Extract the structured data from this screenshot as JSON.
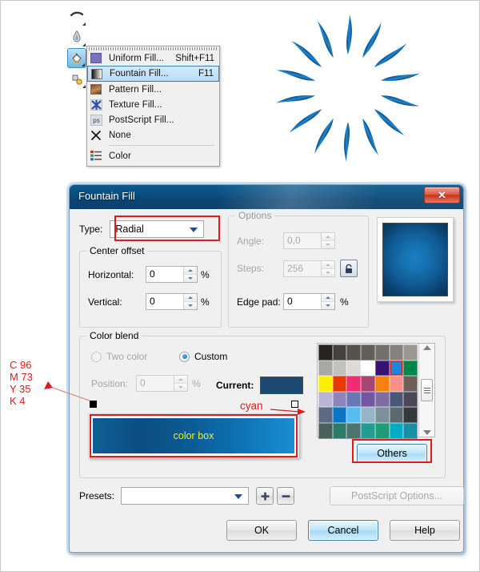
{
  "toolbar": {
    "tools": [
      {
        "name": "outline-pen-tool",
        "selected": false
      },
      {
        "name": "eyedropper-tool",
        "selected": false
      },
      {
        "name": "fill-tool",
        "selected": true
      },
      {
        "name": "interactive-fill-tool",
        "selected": false
      }
    ]
  },
  "fill_flyout": {
    "items": [
      {
        "label": "Uniform Fill...",
        "shortcut": "Shift+F11",
        "icon": "uniform-fill-icon",
        "highlighted": false
      },
      {
        "label": "Fountain Fill...",
        "shortcut": "F11",
        "icon": "fountain-fill-icon",
        "highlighted": true
      },
      {
        "label": "Pattern Fill...",
        "shortcut": "",
        "icon": "pattern-fill-icon",
        "highlighted": false
      },
      {
        "label": "Texture Fill...",
        "shortcut": "",
        "icon": "texture-fill-icon",
        "highlighted": false
      },
      {
        "label": "PostScript Fill...",
        "shortcut": "",
        "icon": "postscript-fill-icon",
        "highlighted": false
      },
      {
        "label": "None",
        "shortcut": "",
        "icon": "none-fill-icon",
        "highlighted": false
      },
      {
        "label": "Color",
        "shortcut": "",
        "icon": "color-docker-icon",
        "highlighted": false
      }
    ]
  },
  "artwork": {
    "name": "blue-starburst-artwork",
    "petal_count": 14,
    "color": "#1a7fc4"
  },
  "dialog": {
    "title": "Fountain Fill",
    "close_label": "✕",
    "type": {
      "label": "Type:",
      "value": "Radial",
      "highlighted": true
    },
    "center_offset": {
      "title": "Center offset",
      "horizontal": {
        "label": "Horizontal:",
        "value": "0",
        "unit": "%"
      },
      "vertical": {
        "label": "Vertical:",
        "value": "0",
        "unit": "%"
      }
    },
    "options": {
      "title": "Options",
      "angle": {
        "label": "Angle:",
        "value": "0,0",
        "disabled": true
      },
      "steps": {
        "label": "Steps:",
        "value": "256",
        "disabled": true
      },
      "lock_icon": "lock-icon",
      "edge_pad": {
        "label": "Edge pad:",
        "value": "0",
        "unit": "%",
        "disabled": false
      }
    },
    "color_blend": {
      "title": "Color blend",
      "two_color_label": "Two color",
      "two_color_selected": false,
      "custom_label": "Custom",
      "custom_selected": true,
      "position": {
        "label": "Position:",
        "value": "0",
        "unit": "%",
        "disabled": true
      },
      "current_label": "Current:",
      "current_color": "#1c4a73",
      "blend_box_label": "color box",
      "blend_box_text_color": "#f2f20a",
      "blend_from": "#0e5f96",
      "blend_to": "#1b8ed4",
      "others_label": "Others"
    },
    "presets": {
      "label": "Presets:",
      "value": "",
      "add_label": "+",
      "remove_label": "−",
      "postscript_label": "PostScript Options..."
    },
    "buttons": {
      "ok": "OK",
      "cancel": "Cancel",
      "help": "Help"
    },
    "preview": {
      "name": "fountain-fill-preview",
      "center_color": "#1a7fc4",
      "edge_color": "#07314f"
    },
    "palette": {
      "selected_color": "#1e86d8",
      "rows": [
        [
          "#27241f",
          "#46423d",
          "#55514b",
          "#625e58",
          "#73706b",
          "#85827d",
          "#9b9894"
        ],
        [
          "#a9a7a3",
          "#c3c1bd",
          "#dcdad6",
          "#ffffff",
          "#3a1175",
          "#1e86d8",
          "#00854a"
        ],
        [
          "#fcee04",
          "#e83a05",
          "#ef2e72",
          "#a74673",
          "#f5820b",
          "#f79089",
          "#6e6058"
        ],
        [
          "#bcb3d9",
          "#8e83bd",
          "#6878b6",
          "#7356a4",
          "#7e6da3",
          "#4b5779",
          "#4b4757"
        ],
        [
          "#5b6b83",
          "#0b77c4",
          "#56bdf0",
          "#96b4c8",
          "#7c909b",
          "#5b6a70",
          "#343a3c"
        ],
        [
          "#4a605c",
          "#2f7a6b",
          "#4d7470",
          "#1f9e91",
          "#1e9b78",
          "#00acc6",
          "#1a8fa5"
        ]
      ]
    }
  },
  "annotations": {
    "cmyk": {
      "c": "C 96",
      "m": "M 73",
      "y": "Y 35",
      "k": "K 4"
    },
    "cyan_label": "cyan"
  }
}
